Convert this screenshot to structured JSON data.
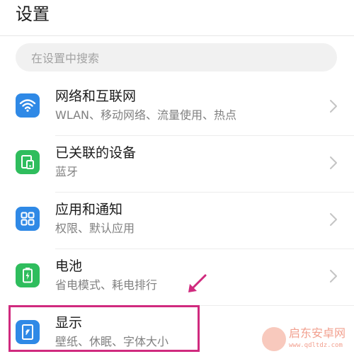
{
  "header": {
    "title": "设置"
  },
  "search": {
    "placeholder": "在设置中搜索"
  },
  "settings": {
    "items": [
      {
        "label": "网络和互联网",
        "sub": "WLAN、移动网络、流量使用、热点",
        "icon": "wifi-icon",
        "color": "#2f89e6"
      },
      {
        "label": "已关联的设备",
        "sub": "蓝牙",
        "icon": "devices-icon",
        "color": "#2fbd5d"
      },
      {
        "label": "应用和通知",
        "sub": "权限、默认应用",
        "icon": "apps-icon",
        "color": "#2f89e6"
      },
      {
        "label": "电池",
        "sub": "省电模式、耗电排行",
        "icon": "battery-icon",
        "color": "#2fbd5d"
      },
      {
        "label": "显示",
        "sub": "壁纸、休眠、字体大小",
        "icon": "display-icon",
        "color": "#2f89e6"
      }
    ]
  },
  "annotation": {
    "highlight_color": "#d02a7e"
  },
  "watermark": {
    "text": "启东安卓网",
    "url": "www.qdltdz.com"
  }
}
